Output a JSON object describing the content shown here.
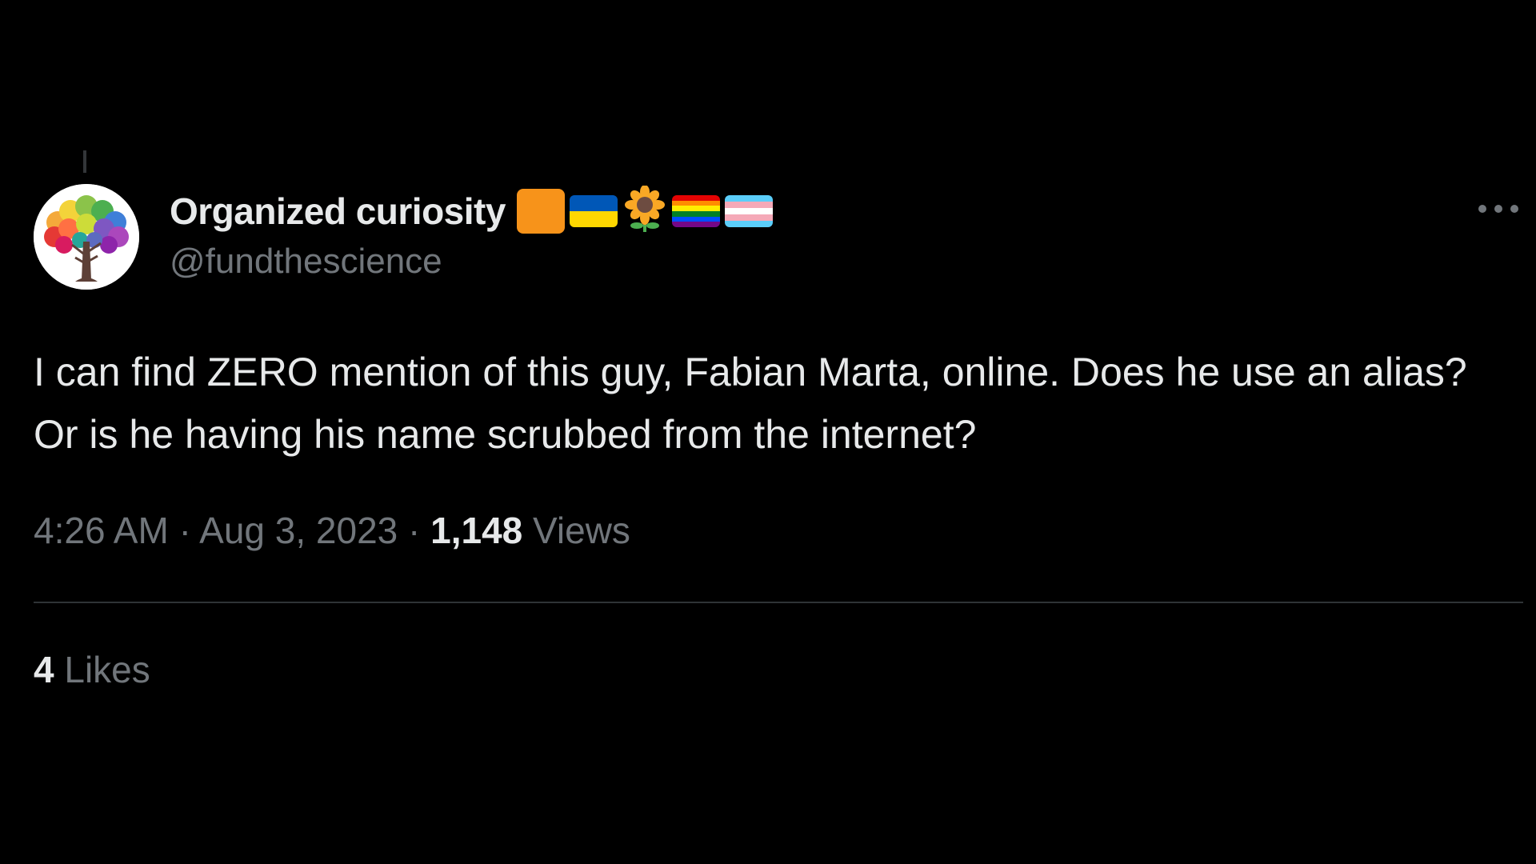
{
  "tweet": {
    "display_name": "Organized curiosity",
    "handle": "@fundthescience",
    "badges": [
      "orange-square-badge",
      "ukraine-flag-icon",
      "sunflower-icon",
      "rainbow-flag-icon",
      "transgender-flag-icon"
    ],
    "text": "I can find ZERO mention of this guy, Fabian Marta, online. Does he use an alias? Or is he having his name scrubbed from the internet?",
    "time": "4:26 AM",
    "date": "Aug 3, 2023",
    "separator": "·",
    "views_count": "1,148",
    "views_label": "Views",
    "likes_count": "4",
    "likes_label": "Likes"
  },
  "colors": {
    "background": "#000000",
    "primary_text": "#e7e9ea",
    "secondary_text": "#71767b",
    "divider": "#2f3336",
    "orange_badge": "#f7931a"
  },
  "icons": {
    "more": "more-options-icon",
    "avatar": "tree-avatar"
  }
}
